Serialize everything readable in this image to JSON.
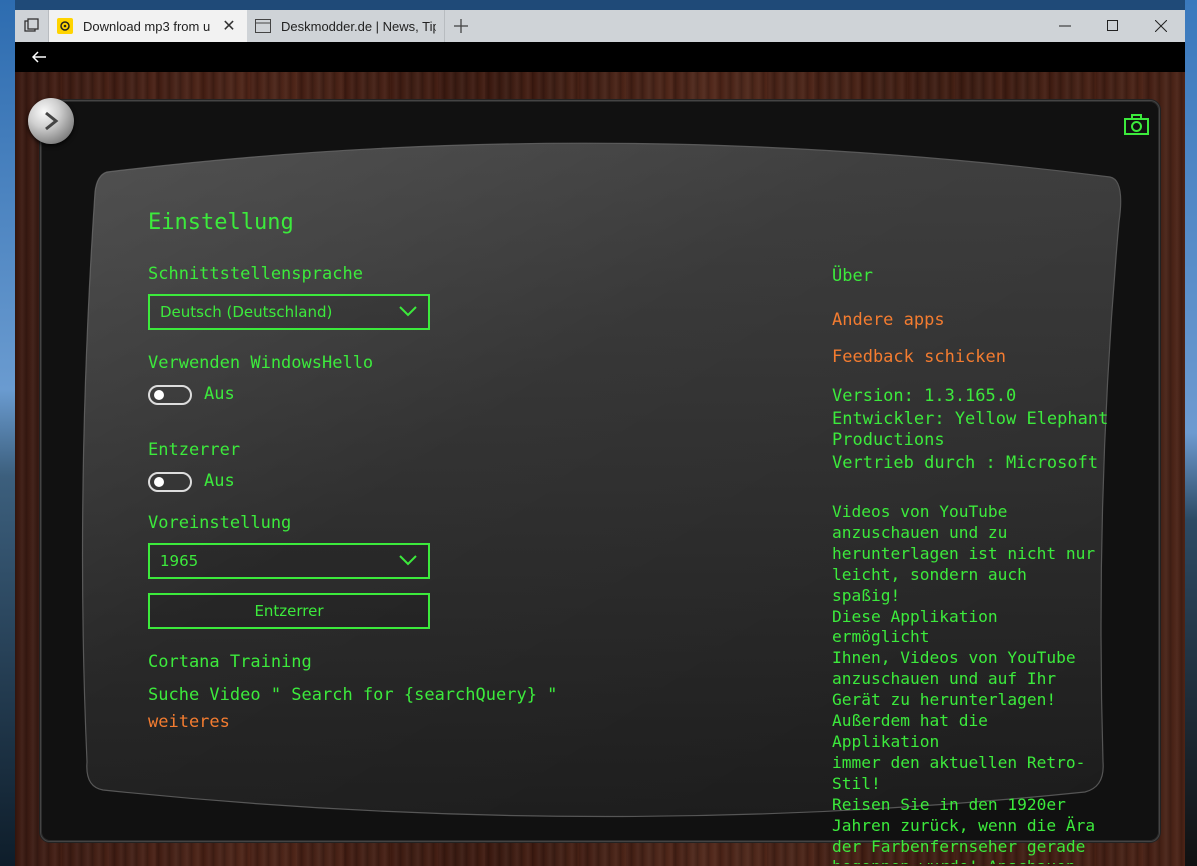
{
  "browser": {
    "tabs": [
      {
        "title": "Download mp3 from u",
        "active": true
      },
      {
        "title": "Deskmodder.de | News, Tip",
        "active": false
      }
    ],
    "window_controls": [
      "minimize",
      "maximize",
      "close"
    ]
  },
  "settings": {
    "heading": "Einstellung",
    "language_label": "Schnittstellensprache",
    "language_value": "Deutsch (Deutschland)",
    "windows_hello_label": "Verwenden WindowsHello",
    "windows_hello_state": "Aus",
    "equalizer_label": "Entzerrer",
    "equalizer_state": "Aus",
    "preset_label": "Voreinstellung",
    "preset_value": "1965",
    "equalizer_button": "Entzerrer",
    "cortana_label": "Cortana Training",
    "cortana_example": "Suche Video  \" Search for {searchQuery} \"",
    "more_link": "weiteres"
  },
  "about": {
    "heading": "Über",
    "other_apps": "Andere apps",
    "feedback": "Feedback schicken",
    "version": "Version: 1.3.165.0",
    "developer_line1": "Entwickler: Yellow Elephant",
    "developer_line2": "Productions",
    "distribution": "Vertrieb durch : Microsoft Stor",
    "description": "Videos von YouTube\nanzuschauen und zu\nherunterlagen ist nicht nur\nleicht, sondern auch spaßig!\nDiese Applikation ermöglicht\nIhnen, Videos von YouTube\nanzuschauen und auf Ihr\nGerät zu herunterlagen!\nAußerdem hat die Applikation\nimmer den aktuellen Retro-Stil!\nReisen Sie in den 1920er\nJahren zurück, wenn die Ära\nder Farbenfernseher gerade\nbegonnen wurde! Anschauen\nSie und genießen!"
  },
  "colors": {
    "accent_green": "#3cea3c",
    "link_orange": "#f47c30",
    "screen_gray": "#2e2e2e"
  },
  "icons": {
    "knob": "play-knob-icon",
    "camera": "camera-icon"
  }
}
